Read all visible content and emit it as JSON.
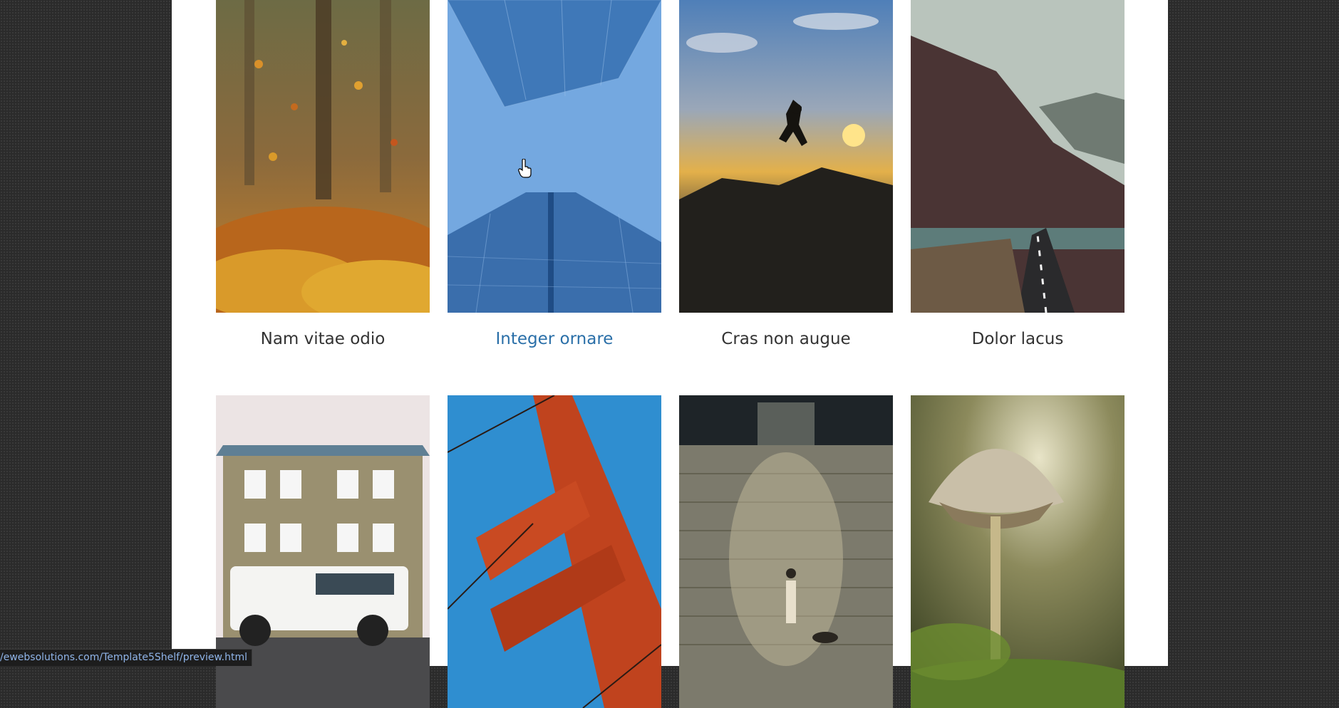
{
  "gallery": {
    "row1": [
      {
        "title": "Nam vitae odio",
        "image": "autumn-leaves-forest"
      },
      {
        "title": "Integer ornare",
        "image": "blue-skyscraper-looking-up"
      },
      {
        "title": "Cras non augue",
        "image": "person-jumping-at-sunset"
      },
      {
        "title": "Dolor lacus",
        "image": "mountain-road-by-lake"
      }
    ],
    "row2": [
      {
        "image": "house-with-white-suv"
      },
      {
        "image": "red-bridge-tower"
      },
      {
        "image": "person-walking-dog-by-stone-wall"
      },
      {
        "image": "mushroom-closeup"
      }
    ]
  },
  "statusbar": {
    "url": "/ewebsolutions.com/Template5Shelf/preview.html"
  },
  "colors": {
    "link_hover": "#2a6fa8",
    "caption": "#333333",
    "background": "#2b2b2b"
  }
}
